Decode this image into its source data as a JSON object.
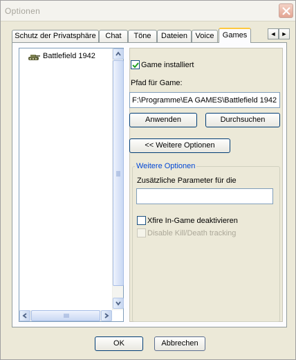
{
  "window": {
    "title": "Optionen"
  },
  "tabs": [
    {
      "label": "Schutz der Privatsphäre"
    },
    {
      "label": "Chat"
    },
    {
      "label": "Töne"
    },
    {
      "label": "Dateien"
    },
    {
      "label": "Voice"
    },
    {
      "label": "Games"
    }
  ],
  "tab_scroll": {
    "left": "◄",
    "right": "►"
  },
  "game_list": {
    "items": [
      {
        "label": "Battlefield 1942",
        "icon": "tank-icon"
      }
    ]
  },
  "settings": {
    "game_installed_label": "Game installiert",
    "game_installed_checked": true,
    "path_label": "Pfad für Game:",
    "path_value": "F:\\Programme\\EA GAMES\\Battlefield 1942",
    "apply_button": "Anwenden",
    "browse_button": "Durchsuchen",
    "more_options_button": "<< Weitere Optionen",
    "group_title": "Weitere Optionen",
    "extra_params_label": "Zusätzliche Parameter für die",
    "extra_params_value": "",
    "ingame_disable_label": "Xfire In-Game deaktivieren",
    "ingame_disable_checked": false,
    "killdeath_label": "Disable Kill/Death tracking",
    "killdeath_checked": false,
    "killdeath_enabled": false
  },
  "footer": {
    "ok_button": "OK",
    "cancel_button": "Abbrechen"
  },
  "colors": {
    "accent": "#0046d5",
    "tab_highlight": "#ffc83c",
    "close": "#e3a492"
  }
}
